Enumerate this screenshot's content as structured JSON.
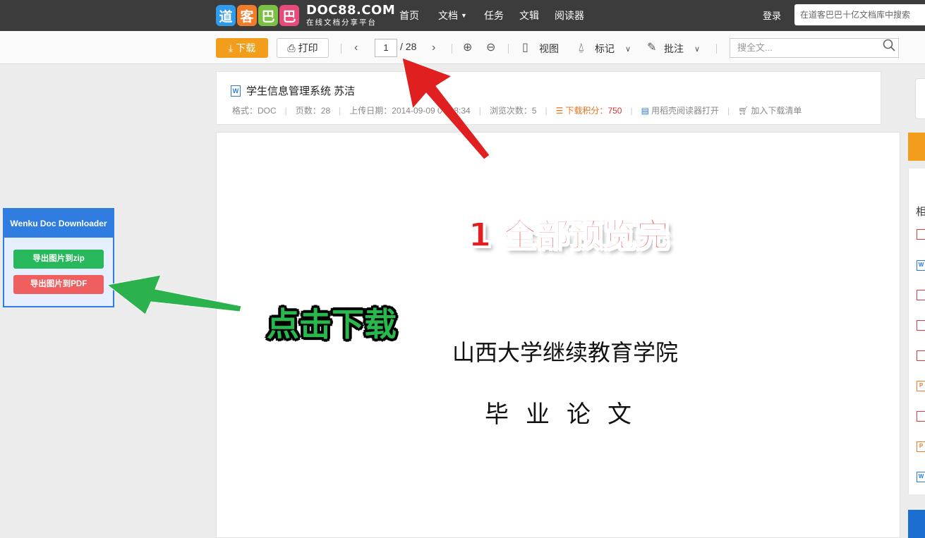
{
  "site": {
    "logo_chars": [
      "道",
      "客",
      "巴",
      "巴"
    ],
    "logo_colors": [
      "#2f9bea",
      "#ef7b2b",
      "#7bc043",
      "#e84a7a"
    ],
    "brand_name": "DOC88.COM",
    "brand_slogan": "在线文档分享平台",
    "nav": {
      "home": "首页",
      "docs": "文档",
      "tasks": "任务",
      "collections": "文辑",
      "reader": "阅读器"
    },
    "login": "登录",
    "search_placeholder": "在道客巴巴十亿文档库中搜索"
  },
  "toolbar": {
    "download_label": "下载",
    "print_label": "打印",
    "current_page": "1",
    "total_pages": "/ 28",
    "view_label": "视图",
    "mark_label": "标记",
    "annotate_label": "批注",
    "search_placeholder": "搜全文..."
  },
  "document": {
    "title": "学生信息管理系统 苏洁",
    "meta": {
      "format": "格式：DOC",
      "pages": "页数：28",
      "upload_date": "上传日期：2014-09-09 09:18:34",
      "views": "浏览次数：5",
      "points_label": "下载积分：",
      "points_value": "750",
      "open_reader": "用稻壳阅读器打开",
      "add_to_list": "加入下载清单"
    },
    "page_line1": "山西大学继续教育学院",
    "page_line2": "毕业论文"
  },
  "sidebar": {
    "heading": "相",
    "file_types": [
      "PDF",
      "W",
      "PDF",
      "PDF",
      "PDF",
      "P",
      "PDF",
      "P",
      "W"
    ]
  },
  "extension": {
    "title": "Wenku Doc Downloader",
    "export_zip": "导出图片到zip",
    "export_pdf": "导出图片到PDF"
  },
  "annotations": {
    "step1": "1 全部预览完",
    "click_download": "点击下载",
    "red_arrow_color": "#e02020",
    "green_arrow_color": "#2bb24c"
  }
}
